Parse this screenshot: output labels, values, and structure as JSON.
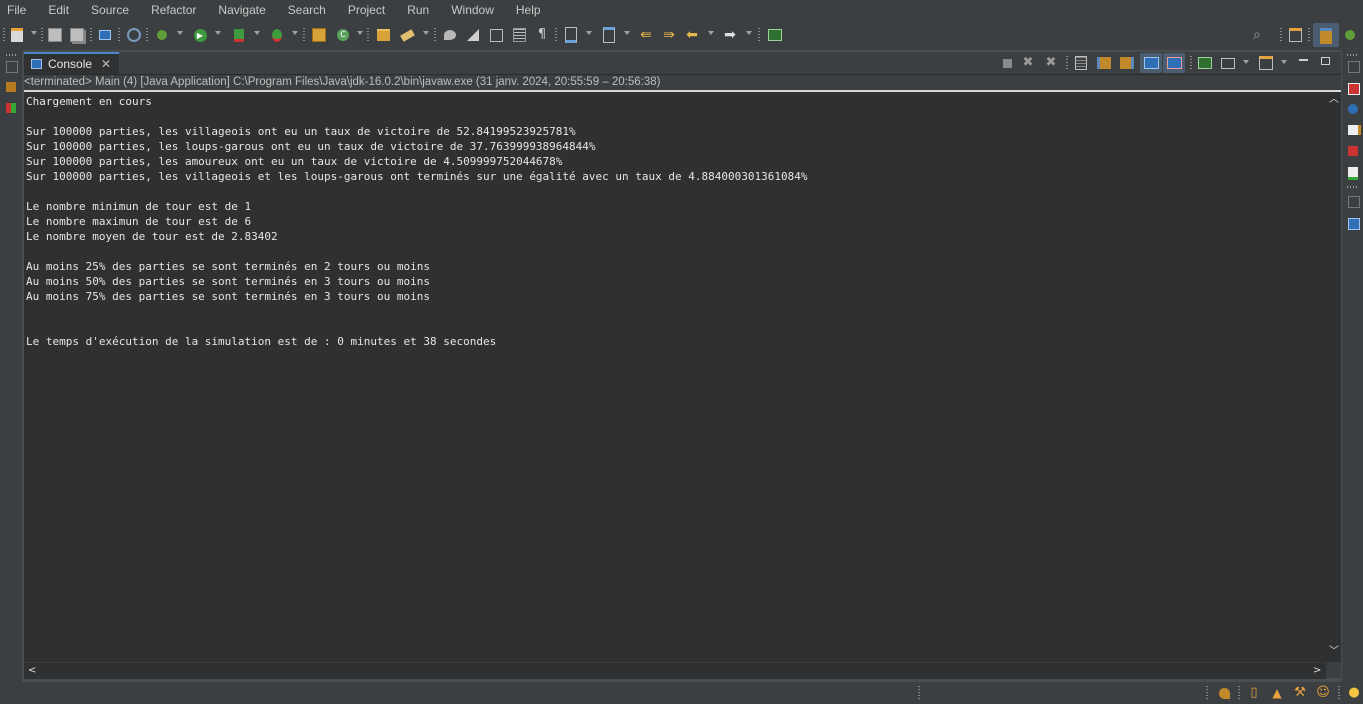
{
  "menu": [
    "File",
    "Edit",
    "Source",
    "Refactor",
    "Navigate",
    "Search",
    "Project",
    "Run",
    "Window",
    "Help"
  ],
  "toolbar_icons": [
    "new-icon",
    "save-icon",
    "save-all-icon",
    "toggle-view-icon",
    "skip-breakpoints-icon",
    "debug-icon",
    "run-icon",
    "coverage-icon",
    "run-external-icon",
    "new-java-project-icon",
    "new-class-icon",
    "open-type-icon",
    "search-icon",
    "toggle-mark-occurrences-icon",
    "block-selection-icon",
    "show-whitespace-icon",
    "next-annotation-icon",
    "previous-annotation-icon",
    "last-edit-location-icon",
    "back-icon",
    "forward-icon",
    "pin-editor-icon"
  ],
  "console": {
    "tab_label": "Console",
    "status_line": "<terminated> Main (4) [Java Application] C:\\Program Files\\Java\\jdk-16.0.2\\bin\\javaw.exe  (31 janv. 2024, 20:55:59 – 20:56:38)",
    "output": "Chargement en cours\n\nSur 100000 parties, les villageois ont eu un taux de victoire de 52.84199523925781%\nSur 100000 parties, les loups-garous ont eu un taux de victoire de 37.763999938964844%\nSur 100000 parties, les amoureux ont eu un taux de victoire de 4.509999752044678%\nSur 100000 parties, les villageois et les loups-garous ont terminés sur une égalité avec un taux de 4.884000301361084%\n\nLe nombre minimun de tour est de 1\nLe nombre maximun de tour est de 6\nLe nombre moyen de tour est de 2.83402\n\nAu moins 25% des parties se sont terminés en 2 tours ou moins\nAu moins 50% des parties se sont terminés en 3 tours ou moins\nAu moins 75% des parties se sont terminés en 3 tours ou moins\n\n\nLe temps d'exécution de la simulation est de : 0 minutes et 38 secondes"
  },
  "colors": {
    "background": "#3c3f41",
    "console_background": "#2f3032",
    "active_tab_accent": "#4a88c7",
    "text": "#e6e6e6"
  }
}
